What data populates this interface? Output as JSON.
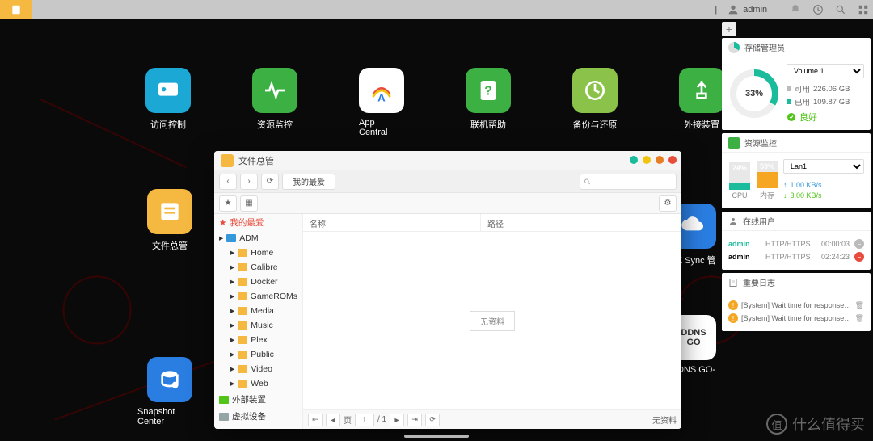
{
  "topbar": {
    "user": "admin"
  },
  "desktop": {
    "row1": [
      "访问控制",
      "资源监控",
      "App Central",
      "联机帮助",
      "备份与还原",
      "外接装置"
    ],
    "col": [
      "文件总管",
      "Snapshot Center"
    ],
    "ez": "EZ Sync 管理",
    "ddns": {
      "line1": "DDNS",
      "line2": "GO",
      "label": "DDNS GO-中"
    }
  },
  "fm": {
    "title": "文件总管",
    "crumb": "我的最爱",
    "fav_label": "我的最爱",
    "adm_label": "ADM",
    "folders": [
      "Home",
      "Calibre",
      "Docker",
      "GameROMs",
      "Media",
      "Music",
      "Plex",
      "Public",
      "Video",
      "Web"
    ],
    "ext_label": "外部装置",
    "vm_label": "虚拟设备",
    "col_name": "名称",
    "col_path": "路径",
    "empty": "无资料",
    "page_label": "页",
    "page_cur": "1",
    "page_total": "/ 1",
    "footer_right": "无资料"
  },
  "sidebar": {
    "storage": {
      "title": "存储管理员",
      "percent": "33%",
      "percent_num": 33,
      "volume": "Volume 1",
      "avail_label": "可用",
      "avail_val": "226.06 GB",
      "used_label": "已用",
      "used_val": "109.87 GB",
      "status": "良好"
    },
    "resmon": {
      "title": "资源监控",
      "cpu_pct": "24%",
      "cpu_num": 24,
      "cpu_label": "CPU",
      "mem_pct": "59%",
      "mem_num": 59,
      "mem_label": "内存",
      "lan": "Lan1",
      "up": "1.00 KB/s",
      "down": "3.00 KB/s"
    },
    "users": {
      "title": "在线用户",
      "rows": [
        {
          "name": "admin",
          "proto": "HTTP/HTTPS",
          "time": "00:00:03",
          "active": true,
          "col": "#bbb"
        },
        {
          "name": "admin",
          "proto": "HTTP/HTTPS",
          "time": "02:24:23",
          "active": false,
          "col": "#e74c3c"
        }
      ]
    },
    "logs": {
      "title": "重要日志",
      "rows": [
        "[System] Wait time for response excee…",
        "[System] Wait time for response excee…"
      ]
    }
  },
  "watermark": {
    "glyph": "值",
    "text": "什么值得买"
  }
}
